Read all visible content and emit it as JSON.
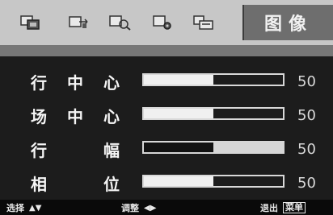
{
  "tabs": {
    "icons": [
      "picture-adjust-icon",
      "sound-icon",
      "geometry-icon",
      "setup-icon",
      "input-icon"
    ],
    "active_label": "图像"
  },
  "menu": {
    "items": [
      {
        "label_chars": [
          "行",
          "中",
          "心"
        ],
        "value": "50",
        "level": 0.5
      },
      {
        "label_chars": [
          "场",
          "中",
          "心"
        ],
        "value": "50",
        "level": 0.5
      },
      {
        "label_chars": [
          "行",
          "幅"
        ],
        "value": "50",
        "level": 0.5
      },
      {
        "label_chars": [
          "相",
          "位"
        ],
        "value": "50",
        "level": 0.5
      }
    ],
    "selected_index": 2
  },
  "hints": {
    "select_label": "选择",
    "select_symbol": "▲▼",
    "adjust_label": "调整",
    "adjust_symbol": "◀▶",
    "exit_label": "退出",
    "menu_key_label": "菜单"
  },
  "colors": {
    "tab_bar": "#c7c7c7",
    "active_tab": "#6e6e6e",
    "panel": "#1c1c1c",
    "bar_fill": "#f0f0f0"
  }
}
